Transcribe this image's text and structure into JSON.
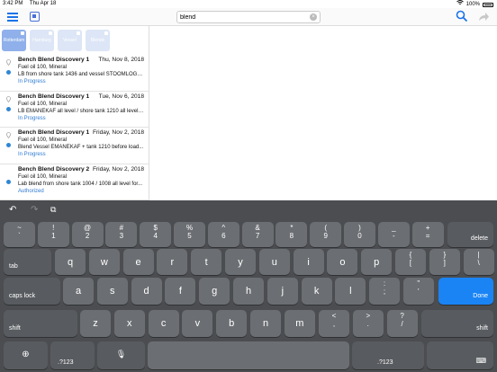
{
  "status_bar": {
    "time": "3:42 PM",
    "date": "Thu Apr 18",
    "battery": "100%"
  },
  "search": {
    "value": "blend",
    "placeholder": ""
  },
  "filters": [
    {
      "label": "Rotterdam"
    },
    {
      "label": "Hamburg"
    },
    {
      "label": "Vessel"
    },
    {
      "label": "Blends"
    }
  ],
  "list": [
    {
      "title": "Bench Blend Discovery 1",
      "date": "Thu, Nov 8, 2018",
      "product": "Fuel oil 100, Mineral",
      "description": "LB from shore tank 1436 and vessel STOOMLOGG...",
      "status": "In Progress"
    },
    {
      "title": "Bench Blend Discovery 1",
      "date": "Tue, Nov 6, 2018",
      "product": "Fuel oil 100, Mineral",
      "description": "LB EMANEKAF all level / shore tank 1210 all level A...",
      "status": "In Progress"
    },
    {
      "title": "Bench Blend Discovery 1",
      "date": "Friday, Nov 2, 2018",
      "product": "Fuel oil 100, Mineral",
      "description": "Blend Vessel EMANEKAF + tank 1210  before load...",
      "status": "In Progress"
    },
    {
      "title": "Bench Blend Discovery 2",
      "date": "Friday, Nov 2, 2018",
      "product": "Fuel oil 100, Mineral",
      "description": "Lab blend from shore tank 1004 / 1008 all level for...",
      "status": "Authorized"
    }
  ],
  "keyboard": {
    "row1": [
      [
        "~",
        "`"
      ],
      [
        "!",
        "1"
      ],
      [
        "@",
        "2"
      ],
      [
        "#",
        "3"
      ],
      [
        "$",
        "4"
      ],
      [
        "%",
        "5"
      ],
      [
        "^",
        "6"
      ],
      [
        "&",
        "7"
      ],
      [
        "*",
        "8"
      ],
      [
        "(",
        "9"
      ],
      [
        ")",
        "0"
      ],
      [
        "_",
        "-"
      ],
      [
        "+",
        "="
      ]
    ],
    "delete": "delete",
    "tab": "tab",
    "row2": [
      "q",
      "w",
      "e",
      "r",
      "t",
      "y",
      "u",
      "i",
      "o",
      "p"
    ],
    "row2_extra": [
      [
        "{",
        "["
      ],
      [
        "}",
        "]"
      ],
      [
        "|",
        "\\"
      ]
    ],
    "caps": "caps lock",
    "row3": [
      "a",
      "s",
      "d",
      "f",
      "g",
      "h",
      "j",
      "k",
      "l"
    ],
    "row3_extra": [
      [
        ":",
        ";"
      ],
      [
        "\"",
        "'"
      ]
    ],
    "done": "Done",
    "shift": "shift",
    "row4": [
      "z",
      "x",
      "c",
      "v",
      "b",
      "n",
      "m"
    ],
    "row4_extra": [
      [
        "<",
        ","
      ],
      [
        ">",
        "."
      ],
      [
        "?",
        "/"
      ]
    ],
    "numkey": ".?123"
  }
}
